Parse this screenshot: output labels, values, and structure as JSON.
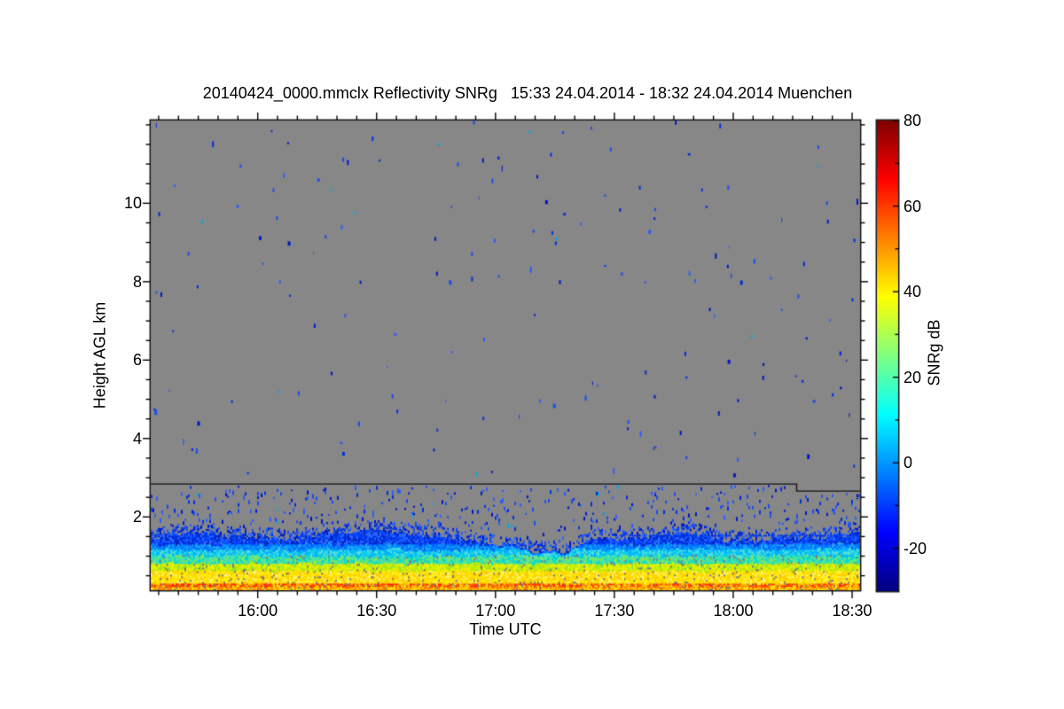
{
  "title": "20140424_0000.mmclx Reflectivity SNRg   15:33 24.04.2014 - 18:32 24.04.2014 Muenchen",
  "chart_data": {
    "type": "heatmap",
    "title": "20140424_0000.mmclx Reflectivity SNRg   15:33 24.04.2014 - 18:32 24.04.2014 Muenchen",
    "xlabel": "Time UTC",
    "ylabel": "Height AGL km",
    "station": "Muenchen",
    "time_start": "15:33 24.04.2014",
    "time_end": "18:32 24.04.2014",
    "x_ticks": [
      "16:00",
      "16:30",
      "17:00",
      "17:30",
      "18:00",
      "18:30"
    ],
    "x_tick_minutes": [
      27,
      57,
      87,
      117,
      147,
      177
    ],
    "x_minor_step_min": 5,
    "x_minor_offset_min": 2,
    "x_range_minutes": [
      0,
      179
    ],
    "y_ticks": [
      "2",
      "4",
      "6",
      "8",
      "10"
    ],
    "y_tick_km": [
      2,
      4,
      6,
      8,
      10
    ],
    "y_minor_step_km": 0.5,
    "y_range_km": [
      0.13,
      12.11
    ],
    "grid": false,
    "background": "#878787",
    "seed": 1337,
    "colorbar": {
      "label": "SNRg dB",
      "ticks": [
        "80",
        "60",
        "40",
        "20",
        "0",
        "-20"
      ],
      "tick_values": [
        80,
        60,
        40,
        20,
        0,
        -20
      ],
      "minor_step": 10,
      "range": [
        -30,
        80
      ],
      "gradient": [
        {
          "v": 80,
          "color": "#7f0000"
        },
        {
          "v": 66.25,
          "color": "#ff0000"
        },
        {
          "v": 38.75,
          "color": "#ffff00"
        },
        {
          "v": 11.25,
          "color": "#00ffff"
        },
        {
          "v": -16.25,
          "color": "#0000ff"
        },
        {
          "v": -30,
          "color": "#00007f"
        }
      ]
    },
    "filter_line": {
      "color": "#141414",
      "km_left": 2.85,
      "km_right": 2.67,
      "step_minute": 163
    },
    "band_top_profile": [
      [
        0,
        1.48
      ],
      [
        10,
        1.58
      ],
      [
        20,
        1.5
      ],
      [
        27,
        1.42
      ],
      [
        35,
        1.4
      ],
      [
        45,
        1.55
      ],
      [
        57,
        1.62
      ],
      [
        65,
        1.55
      ],
      [
        75,
        1.45
      ],
      [
        85,
        1.35
      ],
      [
        92,
        1.28
      ],
      [
        98,
        1.08
      ],
      [
        104,
        1.12
      ],
      [
        110,
        1.38
      ],
      [
        117,
        1.42
      ],
      [
        127,
        1.52
      ],
      [
        137,
        1.55
      ],
      [
        147,
        1.35
      ],
      [
        157,
        1.38
      ],
      [
        167,
        1.45
      ],
      [
        179,
        1.55
      ]
    ],
    "band_tops_km": {
      "yellow": 0.6,
      "yellow_green": 0.79,
      "green_cyan": 0.98,
      "cyan": 1.15,
      "light_blue": 1.28
    },
    "bands": [
      {
        "name": "surface-orange",
        "to_km": 0.19,
        "colors": [
          "#ffcc00",
          "#ff9800",
          "#ffe000",
          "#ff7f00"
        ]
      },
      {
        "name": "red-stripe",
        "to_km": 0.28,
        "colors": [
          "#ff2400",
          "#ff5a00",
          "#ff8c00",
          "#ff4400",
          "#ffb400",
          "#ffdc00"
        ]
      },
      {
        "name": "yellow",
        "to_km": "yellow",
        "colors": [
          "#ffe600",
          "#ffd400",
          "#fff26e",
          "#ffc800",
          "#fff000"
        ]
      },
      {
        "name": "yellow-green",
        "to_km": "yellow_green",
        "colors": [
          "#e0f000",
          "#c0ea00",
          "#f2ee00",
          "#96e428"
        ]
      },
      {
        "name": "green-cyan",
        "to_km": "green_cyan",
        "colors": [
          "#50e49b",
          "#2ddec4",
          "#7fe65a",
          "#00d8d2"
        ]
      },
      {
        "name": "cyan",
        "to_km": "cyan",
        "colors": [
          "#00c3f5",
          "#1fd3e8",
          "#00adff",
          "#55dfd8"
        ]
      },
      {
        "name": "light-blue",
        "to_km": "light_blue",
        "colors": [
          "#0096ff",
          "#007cff",
          "#22aaf5",
          "#0064ff"
        ]
      },
      {
        "name": "blue",
        "to_km": "band_top",
        "colors": [
          "#0041ff",
          "#0030dc",
          "#1150ff",
          "#0026bd",
          "#2e6bff"
        ]
      }
    ],
    "fleck_color": "#7c7c7c",
    "fleck_prob": 0.05,
    "speckles": {
      "colors": [
        "#0018c8",
        "#0030e0",
        "#1a4cf0",
        "#2a5cff"
      ],
      "cyan_color": "#00a8e8",
      "cyan_prob": 0.03,
      "upper_count": 170,
      "mid_bernoulli": [
        0.32,
        0.32,
        0.32,
        0.2
      ],
      "near_band_prob": 0.52,
      "fringe_prob": 0.5
    },
    "streaks": [
      {
        "km": 1.52,
        "t_start": 117,
        "t_end": 179,
        "prob": 0.7
      },
      {
        "km": 1.7,
        "t_start": 30,
        "t_end": 75,
        "prob": 0.15
      }
    ]
  }
}
